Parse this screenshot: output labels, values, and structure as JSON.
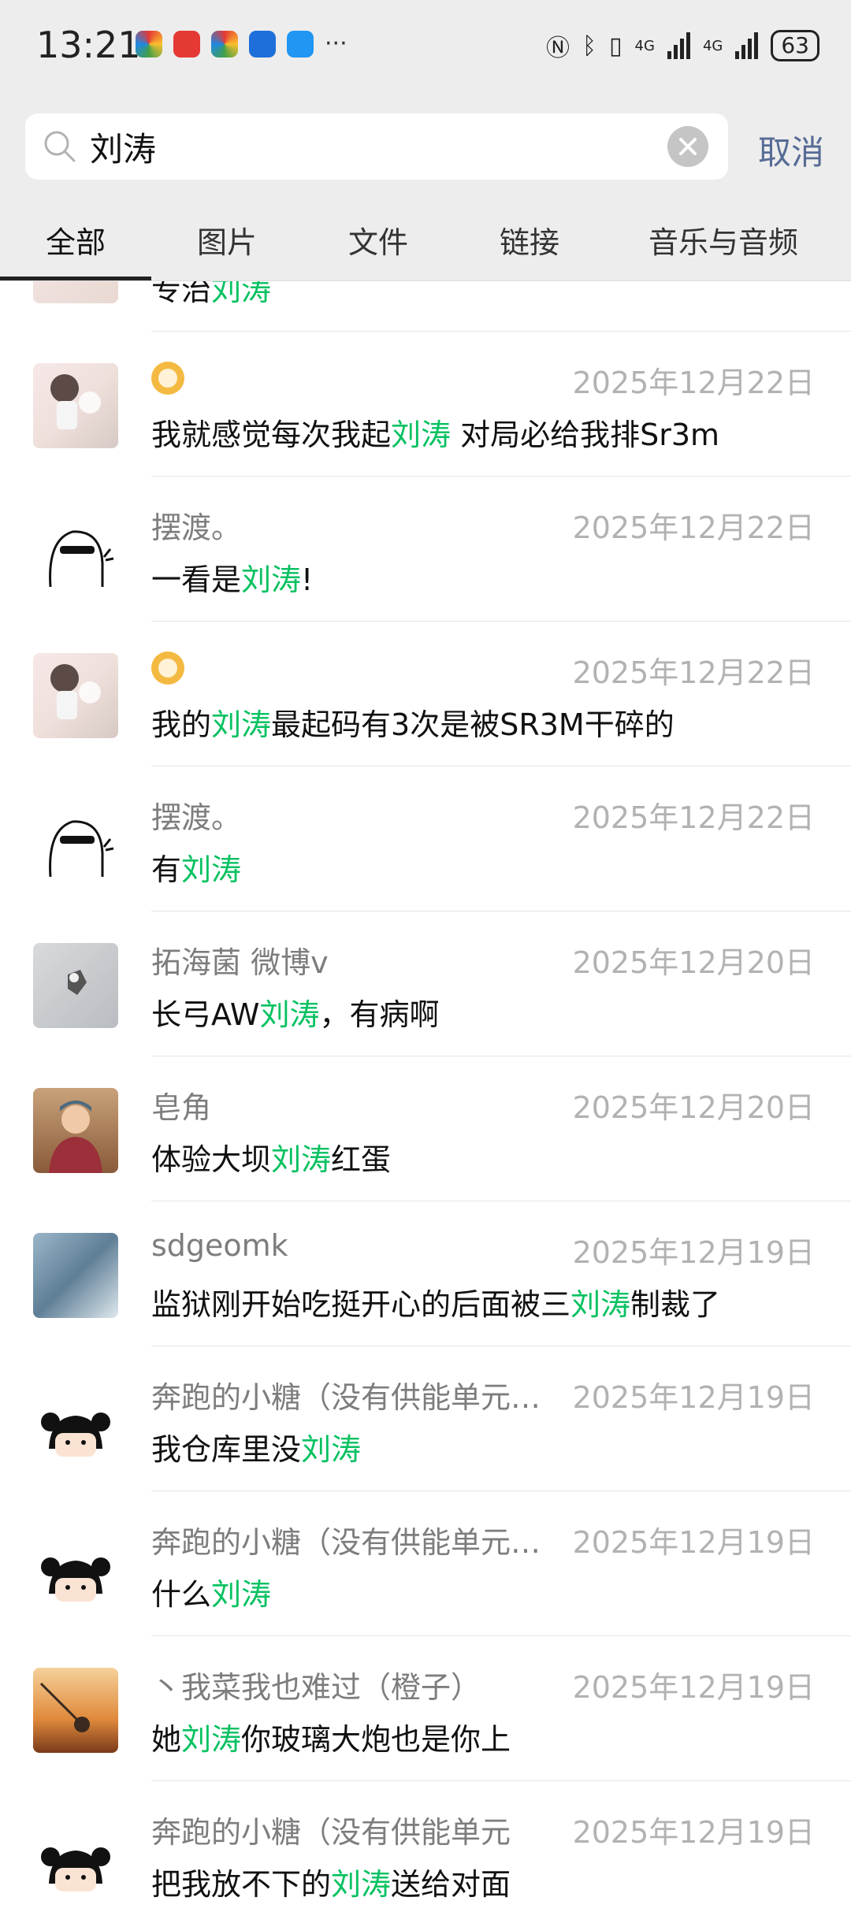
{
  "status_bar": {
    "time": "13:21",
    "battery": "63",
    "network_1": "4G",
    "network_2": "4G"
  },
  "search": {
    "query": "刘涛",
    "cancel_label": "取消"
  },
  "tabs": [
    {
      "label": "全部",
      "active": true
    },
    {
      "label": "图片",
      "active": false
    },
    {
      "label": "文件",
      "active": false
    },
    {
      "label": "链接",
      "active": false
    },
    {
      "label": "音乐与音频",
      "active": false
    }
  ],
  "results": [
    {
      "name": "",
      "date": "",
      "msg_before": "专治",
      "keyword": "刘涛",
      "msg_after": "",
      "avatar": "girl-sketch"
    },
    {
      "name": "lion-emoji",
      "date": "2025年12月22日",
      "msg_before": "我就感觉每次我起",
      "keyword": "刘涛",
      "msg_after": " 对局必给我排Sr3m",
      "avatar": "girl-sketch"
    },
    {
      "name": "摆渡。",
      "date": "2025年12月22日",
      "msg_before": "一看是",
      "keyword": "刘涛",
      "msg_after": "!",
      "avatar": "doodle"
    },
    {
      "name": "lion-emoji",
      "date": "2025年12月22日",
      "msg_before": "我的",
      "keyword": "刘涛",
      "msg_after": "最起码有3次是被SR3M干碎的",
      "avatar": "girl-sketch"
    },
    {
      "name": "摆渡。",
      "date": "2025年12月22日",
      "msg_before": "有",
      "keyword": "刘涛",
      "msg_after": "",
      "avatar": "doodle"
    },
    {
      "name": "拓海菌 微博v",
      "date": "2025年12月20日",
      "msg_before": "长弓AW",
      "keyword": "刘涛",
      "msg_after": "，有病啊",
      "avatar": "cat-gray"
    },
    {
      "name": "皂角",
      "date": "2025年12月20日",
      "msg_before": "体验大坝",
      "keyword": "刘涛",
      "msg_after": "红蛋",
      "avatar": "person-red"
    },
    {
      "name": "sdgeomk",
      "date": "2025年12月19日",
      "msg_before": "监狱刚开始吃挺开心的后面被三",
      "keyword": "刘涛",
      "msg_after": "制裁了",
      "avatar": "glacier"
    },
    {
      "name": "奔跑的小糖（没有供能单元…",
      "date": "2025年12月19日",
      "msg_before": "我仓库里没",
      "keyword": "刘涛",
      "msg_after": "",
      "avatar": "cartoon-girl"
    },
    {
      "name": "奔跑的小糖（没有供能单元…",
      "date": "2025年12月19日",
      "msg_before": "什么",
      "keyword": "刘涛",
      "msg_after": "",
      "avatar": "cartoon-girl"
    },
    {
      "name": "丶我菜我也难过（橙子）",
      "date": "2025年12月19日",
      "msg_before": "她",
      "keyword": "刘涛",
      "msg_after": "你玻璃大炮也是你上",
      "avatar": "sunset"
    },
    {
      "name": "奔跑的小糖（没有供能单元",
      "date": "2025年12月19日",
      "msg_before": "把我放不下的",
      "keyword": "刘涛",
      "msg_after": "送给对面",
      "avatar": "cartoon-girl"
    }
  ]
}
